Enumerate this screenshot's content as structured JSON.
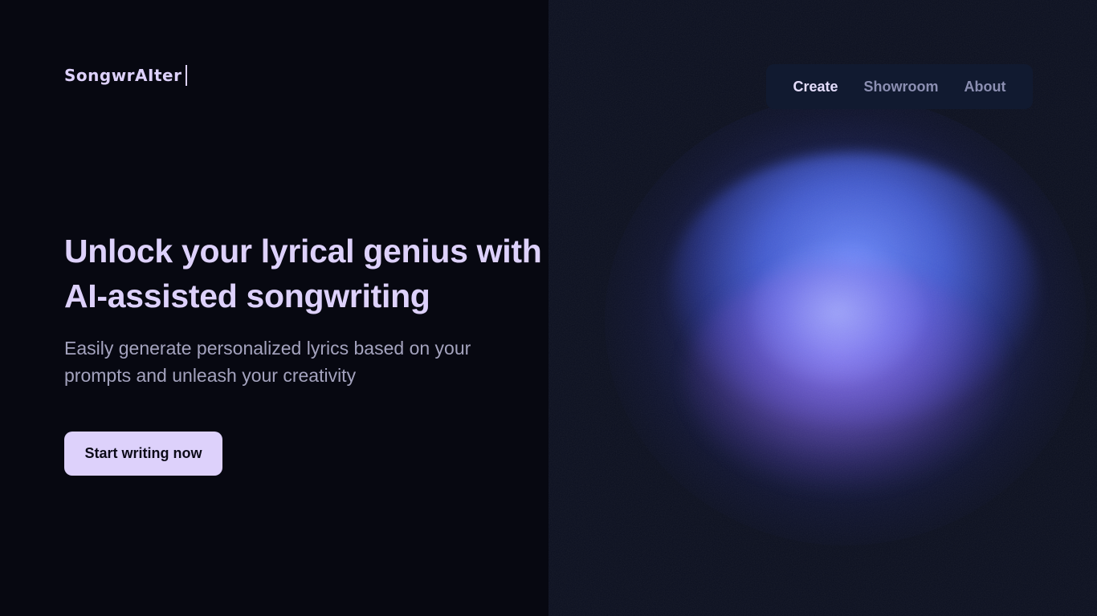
{
  "brand": {
    "name": "SongwrAIter"
  },
  "nav": {
    "items": [
      {
        "label": "Create"
      },
      {
        "label": "Showroom"
      },
      {
        "label": "About"
      }
    ]
  },
  "hero": {
    "title": "Unlock your lyrical genius with AI-assisted songwriting",
    "subtitle": "Easily generate personalized lyrics based on your prompts and unleash your creativity",
    "cta_label": "Start writing now"
  },
  "colors": {
    "background": "#070811",
    "panel": "#0b0f1f",
    "accent": "#ddd1fb",
    "nav_background": "#111a30",
    "muted_text": "#a4a3be"
  }
}
